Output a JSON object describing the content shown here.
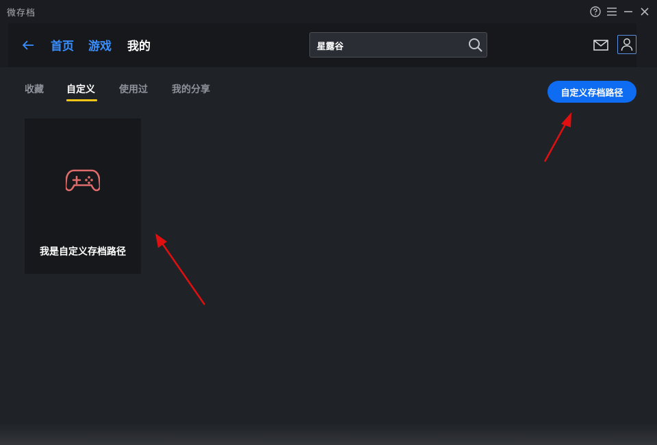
{
  "window": {
    "title": "微存档"
  },
  "nav": {
    "home": "首页",
    "games": "游戏",
    "mine": "我的"
  },
  "search": {
    "value": "星露谷"
  },
  "tabs": [
    {
      "label": "收藏",
      "active": false
    },
    {
      "label": "自定义",
      "active": true
    },
    {
      "label": "使用过",
      "active": false
    },
    {
      "label": "我的分享",
      "active": false
    }
  ],
  "actions": {
    "custom_path_button": "自定义存档路径"
  },
  "cards": [
    {
      "label": "我是自定义存档路径",
      "icon": "gamepad-icon"
    }
  ],
  "colors": {
    "accent_blue": "#3a8fff",
    "primary_button": "#0d6cf2",
    "tab_underline": "#f5c518",
    "gamepad_icon": "#e06c6c",
    "annotation_arrow": "#e01010"
  }
}
